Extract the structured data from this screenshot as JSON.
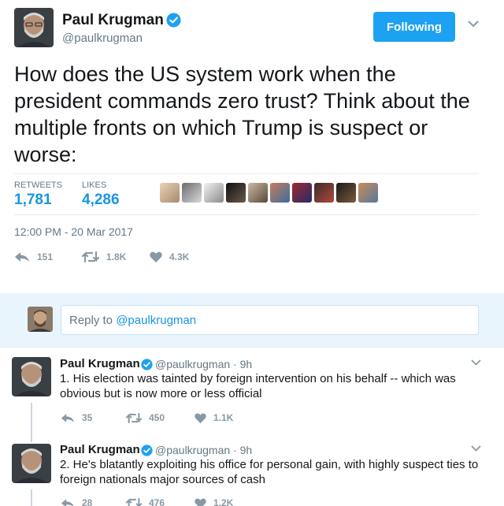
{
  "author": {
    "name": "Paul Krugman",
    "handle": "@paulkrugman",
    "verified": true
  },
  "follow_button": {
    "label": "Following",
    "color": "#1da1f2"
  },
  "main_tweet": {
    "text": "How does the US system work when the president commands zero trust? Think about the multiple fronts on which Trump is suspect or worse:",
    "stats": {
      "retweets_label": "RETWEETS",
      "retweets_value": "1,781",
      "likes_label": "LIKES",
      "likes_value": "4,286"
    },
    "liker_avatar_count": 10,
    "timestamp": "12:00 PM - 20 Mar 2017",
    "actions": {
      "reply_count": "151",
      "retweet_count": "1.8K",
      "like_count": "4.3K"
    }
  },
  "reply_box": {
    "prefix": "Reply to ",
    "mention": "@paulkrugman"
  },
  "thread": [
    {
      "name": "Paul Krugman",
      "meta": "@paulkrugman · 9h",
      "text": "1. His election was tainted by foreign intervention on his behalf -- which was obvious but is now more or less official",
      "reply_count": "35",
      "retweet_count": "450",
      "like_count": "1.1K"
    },
    {
      "name": "Paul Krugman",
      "meta": "@paulkrugman · 9h",
      "text": "2. He's blatantly exploiting his office for personal gain, with highly suspect ties to foreign nationals major sources of cash",
      "reply_count": "28",
      "retweet_count": "476",
      "like_count": "1.2K"
    }
  ],
  "icons": {
    "verified": "verified-badge-icon",
    "caret": "chevron-down-icon",
    "reply": "reply-arrow-icon",
    "retweet": "retweet-icon",
    "like": "heart-icon"
  },
  "colors": {
    "accent": "#1da1f2",
    "link": "#1b95e0",
    "muted": "#657786",
    "reply_bar_bg": "#e8f5fd"
  }
}
